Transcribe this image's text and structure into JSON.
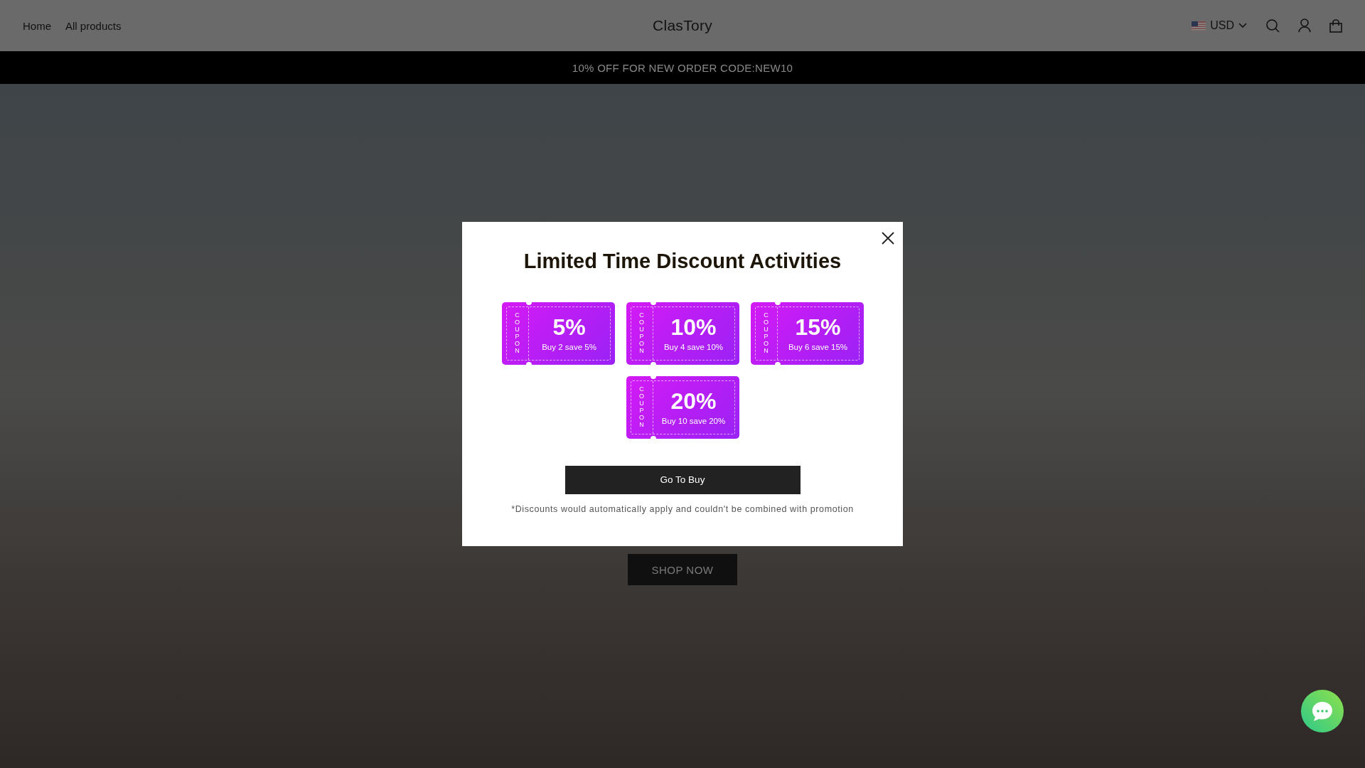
{
  "header": {
    "nav": [
      {
        "label": "Home"
      },
      {
        "label": "All products"
      }
    ],
    "logo": "ClasTory",
    "currency": "USD"
  },
  "announcement": "10% OFF FOR NEW ORDER CODE:NEW10",
  "hero": {
    "button": "SHOP NOW"
  },
  "modal": {
    "title": "Limited Time Discount Activities",
    "coupons": [
      {
        "label": "COUPON",
        "percent": "5%",
        "text": "Buy 2 save 5%"
      },
      {
        "label": "COUPON",
        "percent": "10%",
        "text": "Buy 4 save 10%"
      },
      {
        "label": "COUPON",
        "percent": "15%",
        "text": "Buy 6 save 15%"
      },
      {
        "label": "COUPON",
        "percent": "20%",
        "text": "Buy 10 save 20%"
      }
    ],
    "button": "Go To Buy",
    "note": "*Discounts would automatically apply and couldn't be combined with promotion"
  }
}
